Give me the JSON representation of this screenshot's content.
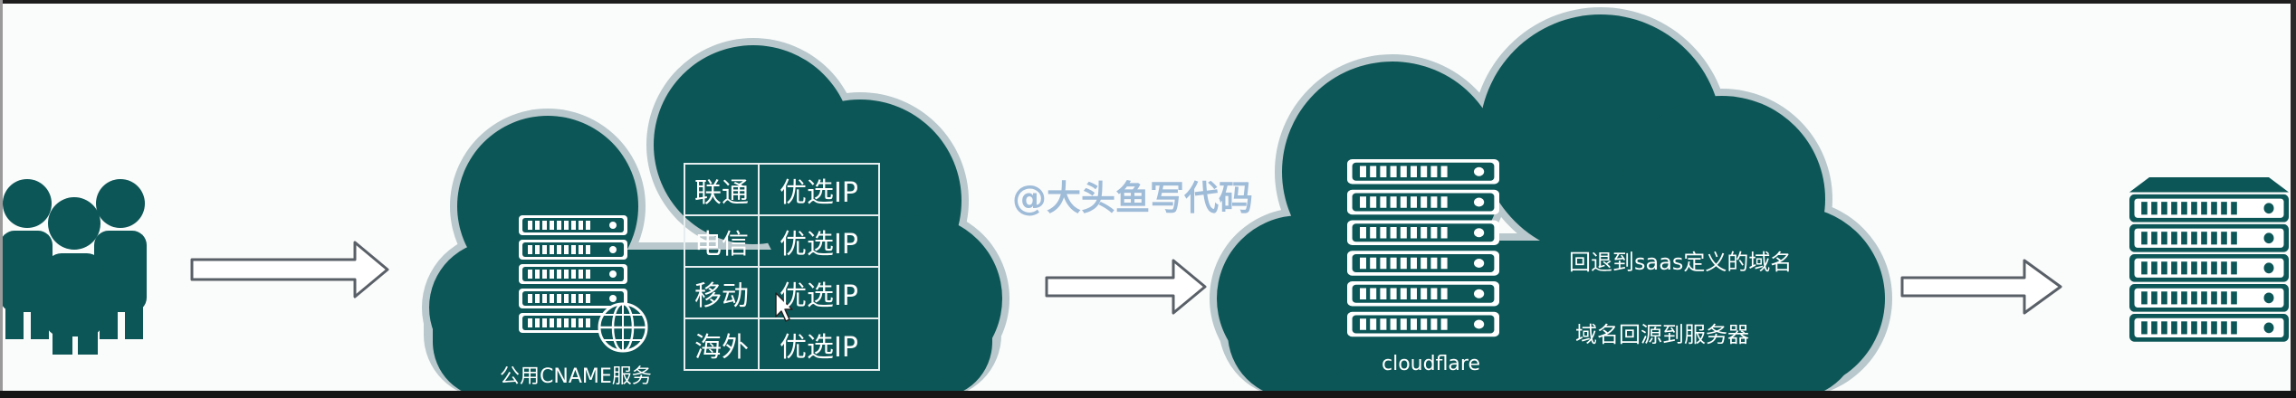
{
  "cdn_cloud": {
    "label": "公用CNAME服务",
    "rows": [
      {
        "isp": "联通",
        "value": "优选IP"
      },
      {
        "isp": "电信",
        "value": "优选IP"
      },
      {
        "isp": "移动",
        "value": "优选IP"
      },
      {
        "isp": "海外",
        "value": "优选IP"
      }
    ]
  },
  "cloudflare_cloud": {
    "label": "cloudflare",
    "note_fallback": "回退到saas定义的域名",
    "note_origin": "域名回源到服务器"
  },
  "watermark": "@大头鱼写代码",
  "colors": {
    "cloud_fill": "#0d5657",
    "cloud_border": "#b8c8cc",
    "icon": "#0d5657",
    "arrow_stroke": "#5a6068"
  },
  "icons": [
    "users-icon",
    "server-icon",
    "globe-icon",
    "arrow-right-icon",
    "mouse-cursor-icon"
  ]
}
